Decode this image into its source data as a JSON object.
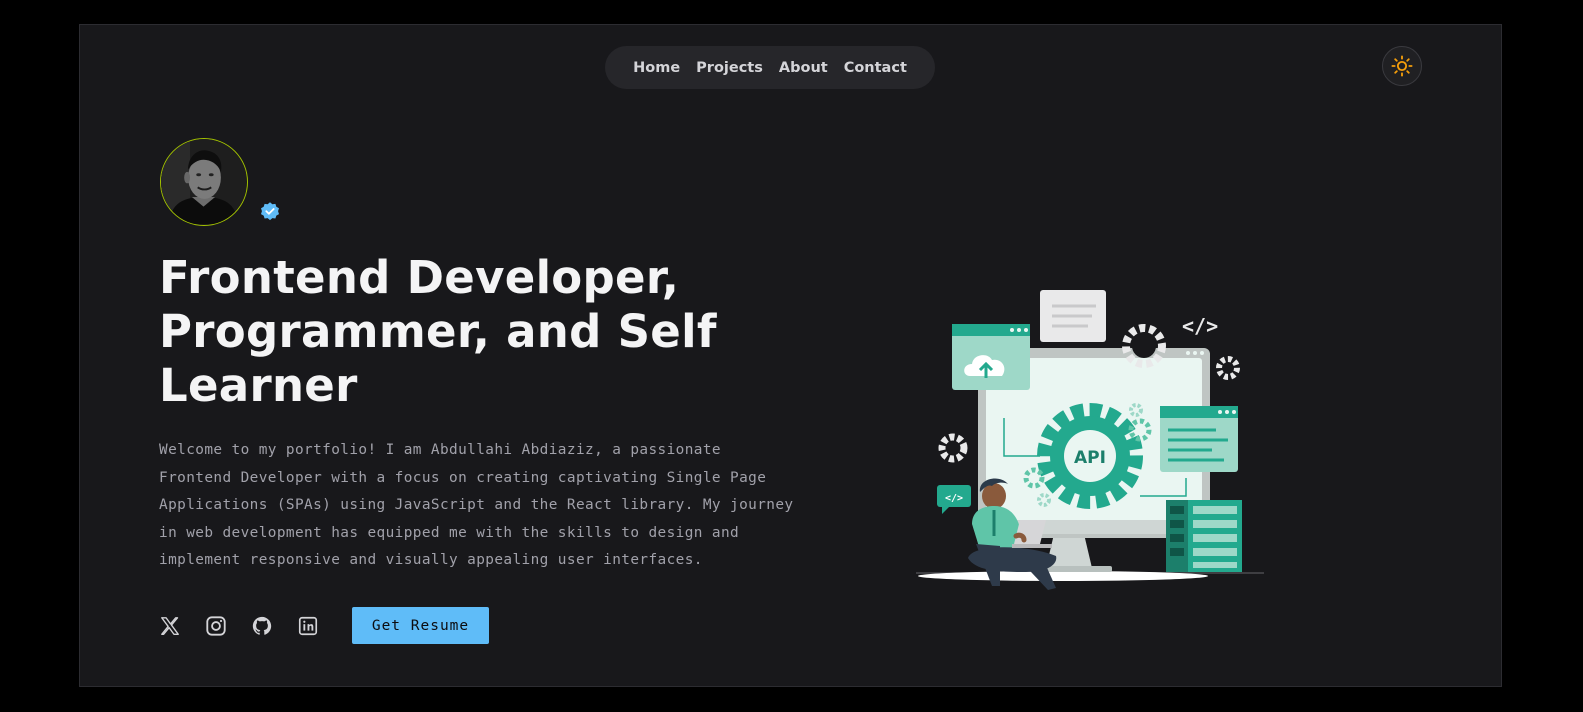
{
  "nav": {
    "items": [
      {
        "label": "Home"
      },
      {
        "label": "Projects"
      },
      {
        "label": "About"
      },
      {
        "label": "Contact"
      }
    ]
  },
  "theme_toggle": {
    "icon": "sun-icon",
    "color": "#f59e0b"
  },
  "profile": {
    "avatar_icon": "profile-photo",
    "verified_icon": "verified-badge-icon",
    "verified_color": "#5fbcf8"
  },
  "hero": {
    "headline": "Frontend Developer, Programmer, and Self Learner",
    "intro": "Welcome to my portfolio! I am Abdullahi Abdiaziz, a passionate Frontend Developer with a focus on creating captivating Single Page Applications (SPAs) using JavaScript and the React library. My journey in web development has equipped me with the skills to design and implement responsive and visually appealing user interfaces."
  },
  "socials": [
    {
      "icon": "x-twitter-icon"
    },
    {
      "icon": "instagram-icon"
    },
    {
      "icon": "github-icon"
    },
    {
      "icon": "linkedin-icon"
    }
  ],
  "resume_button": {
    "label": "Get Resume",
    "color": "#5fbcf8"
  },
  "illustration": {
    "api_label": "API",
    "code_tag_large": "</>",
    "code_tag_small": "</>",
    "accent_color": "#23a98e"
  }
}
